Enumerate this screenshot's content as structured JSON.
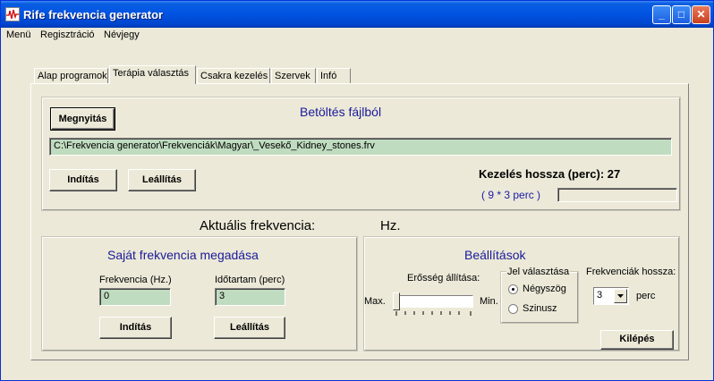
{
  "window": {
    "title": "Rife frekvencia generator"
  },
  "title_buttons": {
    "minimize": "_",
    "maximize": "□",
    "close": "✕"
  },
  "menu": {
    "items": [
      "Menü",
      "Regisztráció",
      "Névjegy"
    ]
  },
  "tabs": [
    "Alap programok",
    "Terápia választás",
    "Csakra kezelés",
    "Szervek",
    "Infó"
  ],
  "active_tab": "Terápia választás",
  "file_section": {
    "open_button": "Megnyitás",
    "title": "Betöltés fájlból",
    "path": "C:\\Frekvencia generator\\Frekvenciák\\Magyar\\_Vesekő_Kidney_stones.frv",
    "start_button": "Indítás",
    "stop_button": "Leállítás",
    "duration_label": "Kezelés hossza (perc): 27",
    "duration_detail": "( 9 * 3 perc )",
    "progress": 0
  },
  "current_frequency": {
    "label": "Aktuális frekvencia:",
    "unit": "Hz."
  },
  "own_frequency": {
    "title": "Saját frekvencia megadása",
    "freq_label": "Frekvencia (Hz.)",
    "freq_value": "0",
    "time_label": "Időtartam (perc)",
    "time_value": "3",
    "start_button": "Indítás",
    "stop_button": "Leállítás"
  },
  "settings": {
    "title": "Beállítások",
    "strength_label": "Erősség állítása:",
    "max_label": "Max.",
    "min_label": "Min.",
    "strength_level": 0,
    "signal_group": "Jel választása",
    "signal_options": [
      "Négyszög",
      "Szinusz"
    ],
    "signal_selected": "Négyszög",
    "length_label": "Frekvenciák hossza:",
    "length_value": "3",
    "length_unit": "perc",
    "exit_button": "Kilépés"
  },
  "colors": {
    "titlebar": "#0054e3",
    "input_bg": "#c0dcc0",
    "accent_blue": "#1a1a9a"
  }
}
